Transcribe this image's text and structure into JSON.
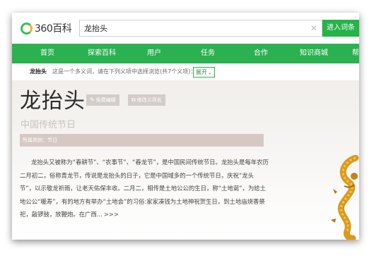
{
  "header": {
    "logo_text": "360百科",
    "search_value": "龙抬头",
    "clear_icon": "close-icon",
    "enter_label": "进入词条"
  },
  "nav": {
    "items": [
      {
        "label": "首页"
      },
      {
        "label": "探索百科"
      },
      {
        "label": "用户"
      },
      {
        "label": "任务"
      },
      {
        "label": "合作"
      },
      {
        "label": "知识商城"
      },
      {
        "label": "帮"
      }
    ],
    "background": "#2bb14f"
  },
  "polysemy": {
    "term": "龙抬头",
    "text": "这是一个多义词，请在下列义项中选择浏览(共7个义项)：",
    "expand_label": "展开"
  },
  "article": {
    "title": "龙抬头",
    "edit_label": "免费编辑",
    "modify_label": "修改义项名",
    "subtitle": "中国传统节日",
    "category": "所属类别：节日",
    "summary": "龙抬头又被称为“春耕节”、“农事节”、“春龙节”，是中国民间传统节日。龙抬头是每年农历二月初二，俗称青龙节，传说是龙抬头的日子，它是中国域多的一个传统节日，庆祝“龙头节”，以示敬龙祈雨，让老天佑保丰收。二月二，相传是土地公公的生日，称“土地诞”，为给土地公公“暖寿”，有的地方有举办“土地会”的习俗:家家凑钱为土地神祝贺生日，到土地庙烧香祭祀，敲锣鼓，放鞭炮。在广西...",
    "more_label": ">>>"
  },
  "colors": {
    "brand_green": "#2bb14f",
    "logo_orange": "#f6b71c",
    "category_bar": "#d6c9c5",
    "dragon_gold": "#d99a1c"
  }
}
